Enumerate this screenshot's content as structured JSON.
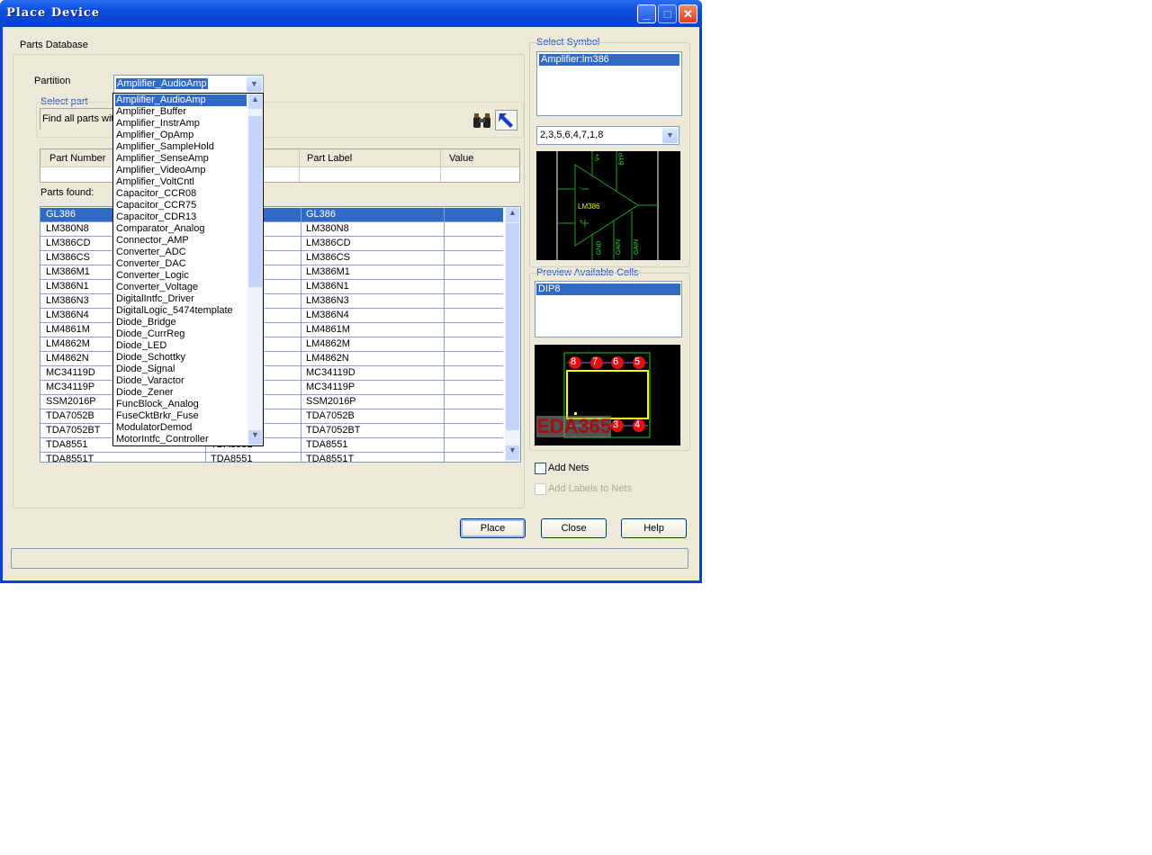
{
  "window": {
    "title": "Place Device",
    "minimize": "_",
    "maximize": "□",
    "close": "✕"
  },
  "parts_database": {
    "tab_label": "Parts Database",
    "partition_label": "Partition",
    "partition_value": "Amplifier_AudioAmp",
    "select_part_label": "Select part",
    "find_text": "Find all parts with",
    "search_icon": "binoculars-icon",
    "pick_icon": "arrow-pointer-icon",
    "columns": [
      "Part Number",
      "",
      "Part Label",
      "Value"
    ],
    "parts_found_label": "Parts found:",
    "rows": [
      [
        "GL386",
        "",
        "GL386",
        ""
      ],
      [
        "LM380N8",
        "",
        "LM380N8",
        ""
      ],
      [
        "LM386CD",
        "",
        "LM386CD",
        ""
      ],
      [
        "LM386CS",
        "",
        "LM386CS",
        ""
      ],
      [
        "LM386M1",
        "",
        "LM386M1",
        ""
      ],
      [
        "LM386N1",
        "",
        "LM386N1",
        ""
      ],
      [
        "LM386N3",
        "",
        "LM386N3",
        ""
      ],
      [
        "LM386N4",
        "",
        "LM386N4",
        ""
      ],
      [
        "LM4861M",
        "",
        "LM4861M",
        ""
      ],
      [
        "LM4862M",
        "",
        "LM4862M",
        ""
      ],
      [
        "LM4862N",
        "",
        "LM4862N",
        ""
      ],
      [
        "MC34119D",
        "",
        "MC34119D",
        ""
      ],
      [
        "MC34119P",
        "",
        "MC34119P",
        ""
      ],
      [
        "SSM2016P",
        "",
        "SSM2016P",
        ""
      ],
      [
        "TDA7052B",
        "",
        "TDA7052B",
        ""
      ],
      [
        "TDA7052BT",
        "",
        "TDA7052BT",
        ""
      ],
      [
        "TDA8551",
        "TDA8551",
        "TDA8551",
        ""
      ],
      [
        "TDA8551T",
        "TDA8551",
        "TDA8551T",
        ""
      ]
    ],
    "partition_options": [
      "Amplifier_AudioAmp",
      "Amplifier_Buffer",
      "Amplifier_InstrAmp",
      "Amplifier_OpAmp",
      "Amplifier_SampleHold",
      "Amplifier_SenseAmp",
      "Amplifier_VideoAmp",
      "Amplifier_VoltCntl",
      "Capacitor_CCR08",
      "Capacitor_CCR75",
      "Capacitor_CDR13",
      "Comparator_Analog",
      "Connector_AMP",
      "Converter_ADC",
      "Converter_DAC",
      "Converter_Logic",
      "Converter_Voltage",
      "DigitalIntfc_Driver",
      "DigitalLogic_5474template",
      "Diode_Bridge",
      "Diode_CurrReg",
      "Diode_LED",
      "Diode_Schottky",
      "Diode_Signal",
      "Diode_Varactor",
      "Diode_Zener",
      "FuncBlock_Analog",
      "FuseCktBrkr_Fuse",
      "ModulatorDemod",
      "MotorIntfc_Controller"
    ]
  },
  "symbol": {
    "label": "Select Symbol",
    "items": [
      "Amplifier:lm386"
    ],
    "pin_order": "2,3,5,6,4,7,1,8",
    "preview": {
      "name": "LM386",
      "pins": [
        "V+",
        "BYP",
        "GND",
        "GAIN",
        "GAIN"
      ],
      "inputs": [
        "-",
        "+"
      ]
    }
  },
  "cells": {
    "label": "Preview Available Cells",
    "items": [
      "DIP8"
    ],
    "pads_top": [
      "8",
      "7",
      "6",
      "5"
    ],
    "pads_bottom": [
      "3",
      "4"
    ],
    "watermark": "EDA365"
  },
  "options": {
    "add_nets": "Add Nets",
    "add_labels": "Add Labels to Nets"
  },
  "buttons": {
    "place": "Place",
    "close": "Close",
    "help": "Help"
  },
  "colors": {
    "selection": "#316ac5",
    "face": "#ece9d8",
    "titlebar": "#0a4ee0"
  }
}
